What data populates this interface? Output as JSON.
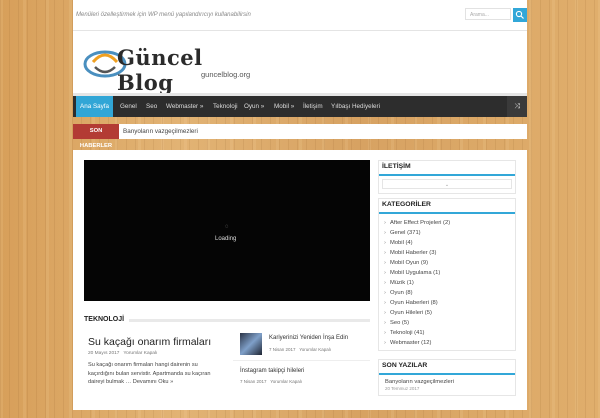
{
  "topbar": {
    "note": "Menüleri özelleştirmek için WP menü yapılandırıcıyı kullanabilirsin",
    "search_placeholder": "Arama..."
  },
  "logo": {
    "title": "Güncel Blog",
    "subtitle": "guncelblog.org"
  },
  "nav": {
    "items": [
      "Ana Sayfa",
      "Genel",
      "Seo",
      "Webmaster »",
      "Teknoloji",
      "Oyun »",
      "Mobil »",
      "İletişim",
      "Yılbaşı Hediyeleri"
    ]
  },
  "ticker": {
    "label": "SON HABERLER",
    "text": "Banyoların vazgeçilmezleri"
  },
  "video": {
    "loading": "Loading"
  },
  "teknoloji": {
    "title": "TEKNOLOJİ",
    "featured": {
      "title": "Su kaçağı onarım firmaları",
      "date": "20 Mayıs 2017",
      "comments": "Yorumlar Kapalı",
      "excerpt": "Su kaçağı onarım firmaları hangi dairenin su kaçırdığını bulan servistir. Apartmanda su kaçıran daireyi bulmak …",
      "more": "Devamını Oku »"
    },
    "side": [
      {
        "title": "Kariyerinizi Yeniden İnşa Edin",
        "date": "7 Nisan 2017",
        "comments": "Yorumlar Kapalı"
      },
      {
        "title": "İnstagram takipçi hileleri",
        "date": "7 Nisan 2017",
        "comments": "Yorumlar Kapalı"
      }
    ]
  },
  "sidebar": {
    "iletisim": {
      "title": "İLETİŞİM"
    },
    "kategoriler": {
      "title": "KATEGORİLER",
      "items": [
        "After Effect Projeleri (2)",
        "Genel (371)",
        "Mobil (4)",
        "Mobil Haberler (3)",
        "Mobil Oyun (9)",
        "Mobil Uygulama (1)",
        "Müzik (1)",
        "Oyun (8)",
        "Oyun Haberleri (8)",
        "Oyun Hileleri (5)",
        "Seo (5)",
        "Teknoloji (41)",
        "Webmaster (12)"
      ]
    },
    "son_yazilar": {
      "title": "SON YAZILAR",
      "first": "Banyoların vazgeçilmezleri",
      "first_date": "20 Temmuz 2017"
    }
  },
  "colors": {
    "accent": "#32a7d8",
    "ticker_red": "#b33b34",
    "nav_bg": "#2d2d2d"
  }
}
